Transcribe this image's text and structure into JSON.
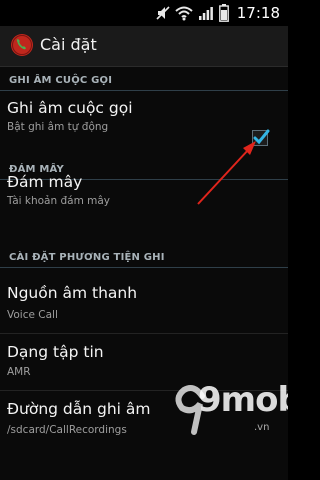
{
  "status_bar": {
    "time": "17:18",
    "icons": [
      "mute-icon",
      "wifi-icon",
      "signal-icon",
      "battery-icon"
    ]
  },
  "app_bar": {
    "title": "Cài đặt",
    "icon": "call-recorder-icon"
  },
  "sections": [
    {
      "header": "GHI ÂM CUỘC GỌI",
      "items": [
        {
          "title": "Ghi âm cuộc gọi",
          "summary": "Bật ghi âm tự động",
          "checked": true
        }
      ]
    },
    {
      "header": "ĐÁM MÂY",
      "items": [
        {
          "title": "Đám mây",
          "summary": "Tài khoản đám mây"
        }
      ]
    },
    {
      "header": "CÀI ĐẶT PHƯƠNG TIỆN GHI",
      "items": [
        {
          "title": "Nguồn âm thanh",
          "summary": "Voice Call"
        },
        {
          "title": "Dạng tập tin",
          "summary": "AMR"
        },
        {
          "title": "Đường dẫn ghi âm",
          "summary": "/sdcard/CallRecordings"
        }
      ]
    }
  ],
  "watermark": {
    "brand": "9mobi",
    "suffix": ".vn"
  },
  "colors": {
    "background": "#0a0a0a",
    "section_header_text": "#a9b3b9",
    "checkbox_check": "#33b5e5",
    "annotation_arrow": "#e0251c"
  }
}
